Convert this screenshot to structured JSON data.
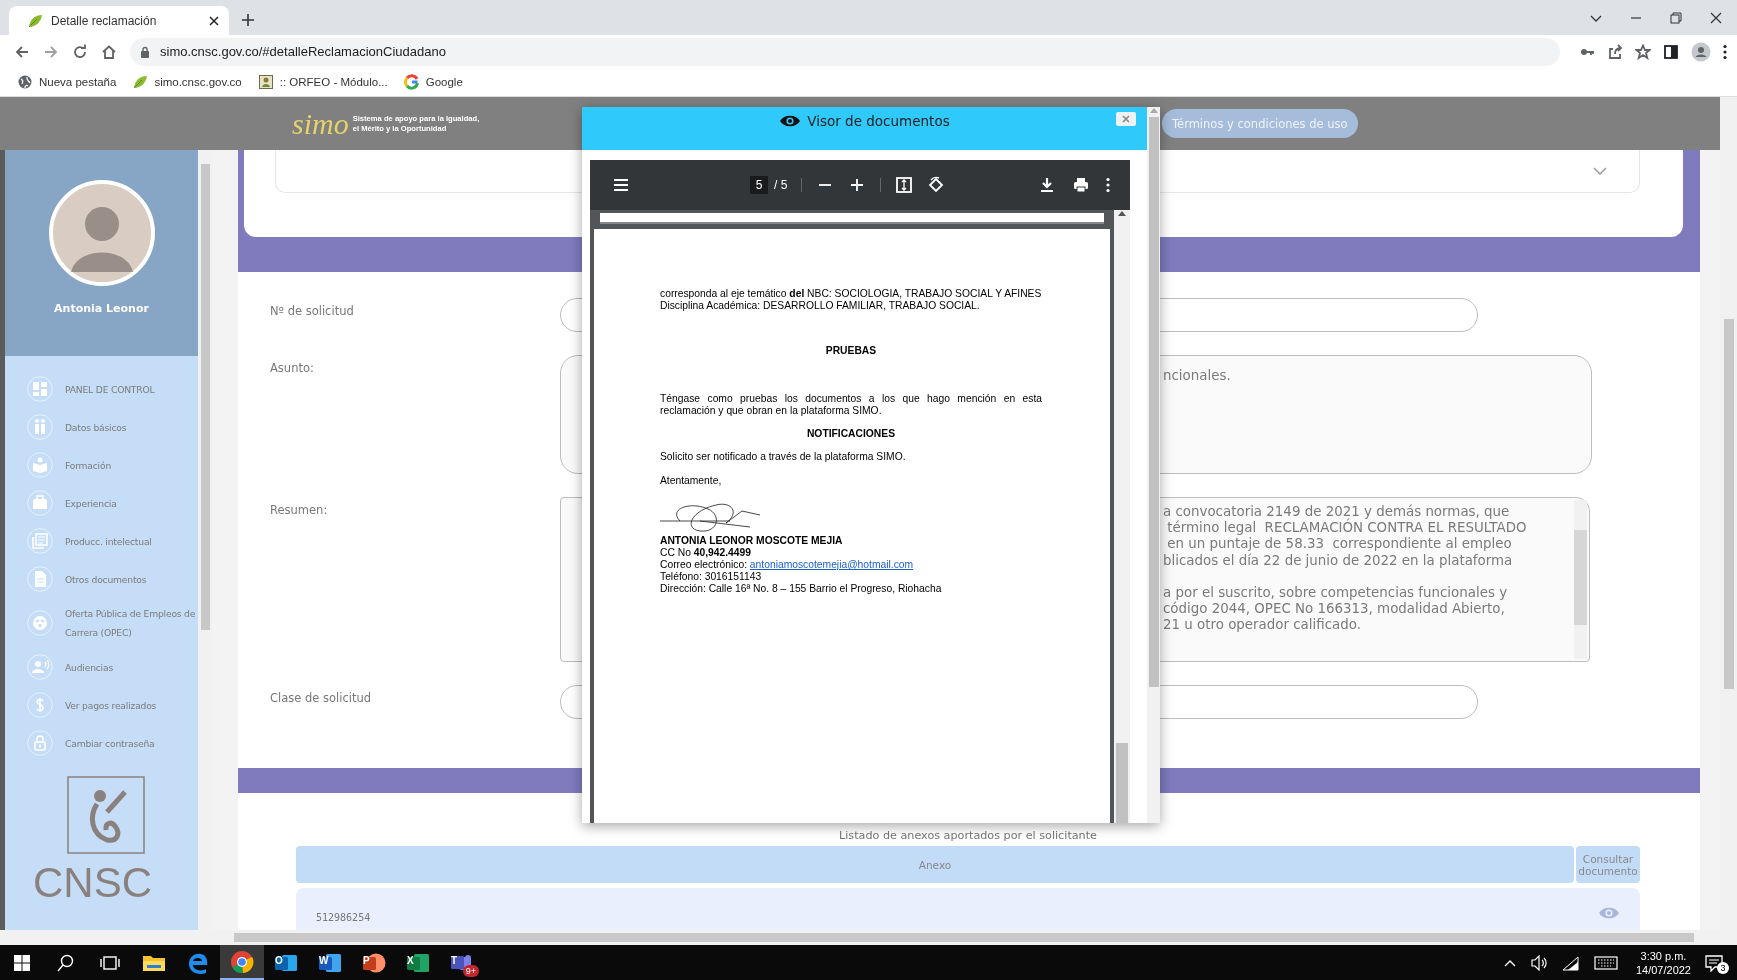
{
  "browser": {
    "tabs": [
      {
        "title": "Detalle reclamación",
        "kind": "leaf",
        "selected": true
      }
    ],
    "url": "simo.cnsc.gov.co/#detalleReclamacionCiudadano",
    "bookmarks": [
      {
        "label": "Nueva pestaña",
        "kind": "globe"
      },
      {
        "label": "simo.cnsc.gov.co",
        "kind": "leaf"
      },
      {
        "label": ":: ORFEO - Módulo...",
        "kind": "framed"
      },
      {
        "label": "Google",
        "kind": "ring"
      }
    ]
  },
  "header": {
    "logo_text": "simo",
    "tagline": [
      "Sistema de apoyo para la Igualdad,",
      "el Mérito y la Oportunidad"
    ],
    "terms_button": "Términos y condiciones de uso"
  },
  "sidebar": {
    "user_name": "Antonia Leonor",
    "items": [
      {
        "label": "PANEL DE CONTROL",
        "kind": "dashboard"
      },
      {
        "label": "Datos básicos",
        "kind": "people"
      },
      {
        "label": "Formación",
        "kind": "reader"
      },
      {
        "label": "Experiencia",
        "kind": "briefcase"
      },
      {
        "label": "Producc. intelectual",
        "kind": "library"
      },
      {
        "label": "Otros documentos",
        "kind": "document"
      },
      {
        "label": "Oferta Pública de Empleos de Carrera (OPEC)",
        "kind": "reel"
      },
      {
        "label": "Audiencias",
        "kind": "speaker"
      },
      {
        "label": "Ver pagos realizados",
        "kind": "dollar"
      },
      {
        "label": "Cambiar contraseña",
        "kind": "lock"
      }
    ],
    "brand": "CNSC"
  },
  "form": {
    "fields": [
      {
        "label": "Nº de solicitud",
        "kind": "input"
      },
      {
        "label": "Asunto:",
        "kind": "textarea",
        "paragraphs": [
          [
            "ncionales."
          ]
        ]
      },
      {
        "label": "Resumen:",
        "kind": "scroll_textarea",
        "paragraphs": [
          [
            "a convocatoria 2149 de 2021 y demás normas, que",
            " término legal  RECLAMACIÓN CONTRA EL RESULTADO",
            " en un puntaje de 58.33  correspondiente al empleo",
            "blicados el día 22 de junio de 2022 en la plataforma"
          ],
          [
            "a por el suscrito, sobre competencias funcionales y",
            "código 2044, OPEC No 166313, modalidad Abierto,",
            "21 u otro operador calificado."
          ]
        ]
      },
      {
        "label": "Clase de solicitud",
        "kind": "input"
      }
    ]
  },
  "annexes": {
    "title": "Listado de anexos aportados por el solicitante",
    "columns": [
      "Anexo",
      "Consultar documento"
    ],
    "rows": [
      {
        "annex": "512986254"
      }
    ]
  },
  "viewer": {
    "title": "Visor de documentos",
    "page": "5",
    "page_total": "/ 5",
    "blocks": [
      {
        "kind": "para",
        "lines": [
          "corresponda al eje temático **del** NBC: SOCIOLOGIA, TRABAJO SOCIAL Y AFINES",
          "Disciplina Académica: DESARROLLO FAMILIAR, TRABAJO SOCIAL."
        ]
      },
      {
        "kind": "heading",
        "text": "PRUEBAS"
      },
      {
        "kind": "justified",
        "text": "Téngase como pruebas los documentos a los que hago mención en esta reclamación y que obran en la plataforma SIMO."
      },
      {
        "kind": "heading",
        "text": "NOTIFICACIONES"
      },
      {
        "kind": "para",
        "lines": [
          "Solicito ser notificado a través de la plataforma SIMO."
        ]
      },
      {
        "kind": "para",
        "lines": [
          "Atentamente,"
        ]
      }
    ],
    "signature": {
      "name": "ANTONIA LEONOR MOSCOTE MEJIA",
      "id_line": "CC No **40,942.4499**",
      "email_label": "Correo electrónico:",
      "email": "antoniamoscotemejia@hotmail.com",
      "phone": "Teléfono: 3016151143",
      "address": "Dirección: Calle 16ª No. 8 – 155 Barrio el Progreso, Riohacha"
    }
  },
  "taskbar": {
    "apps": [
      {
        "kind": "folder",
        "selected": false
      },
      {
        "kind": "edge",
        "selected": false
      },
      {
        "kind": "chrome",
        "selected": true
      },
      {
        "kind": "mail",
        "glyph": "O",
        "selected": false
      },
      {
        "kind": "word",
        "glyph": "W",
        "selected": false
      },
      {
        "kind": "slides",
        "glyph": "P",
        "selected": false
      },
      {
        "kind": "sheet",
        "glyph": "X",
        "selected": false
      },
      {
        "kind": "chat",
        "glyph": "T",
        "badge": "9+",
        "selected": false
      }
    ],
    "time": "3:30 p.m.",
    "date": "14/07/2022",
    "notifications": "3"
  }
}
